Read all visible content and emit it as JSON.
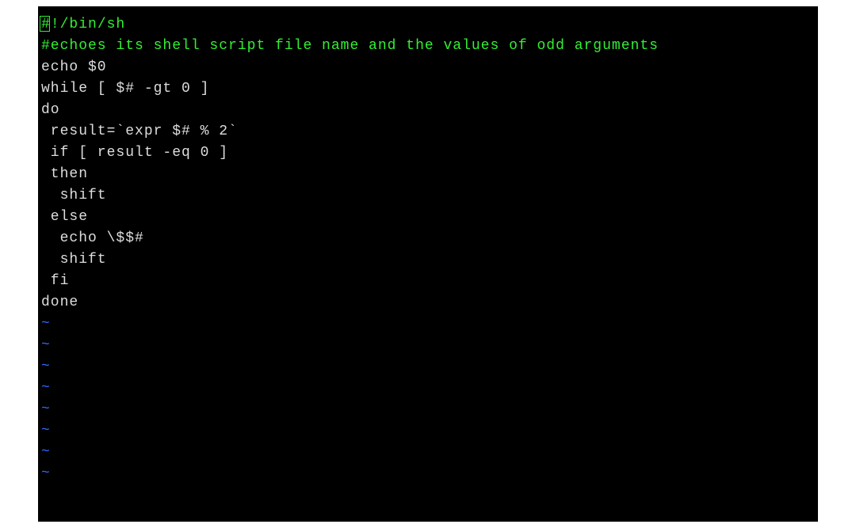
{
  "terminal": {
    "shebang_cursor_char": "#",
    "shebang_rest": "!/bin/sh",
    "comment": "#echoes its shell script file name and the values of odd arguments",
    "blank1": "",
    "line1": "echo $0",
    "line2": "while [ $# -gt 0 ]",
    "line3": "do",
    "line4": " result=`expr $# % 2`",
    "line5": " if [ result -eq 0 ]",
    "line6": " then",
    "line7": "  shift",
    "line8": " else",
    "line9": "  echo \\$$#",
    "line10": "  shift",
    "line11": " fi",
    "line12": "done",
    "tilde": "~"
  }
}
